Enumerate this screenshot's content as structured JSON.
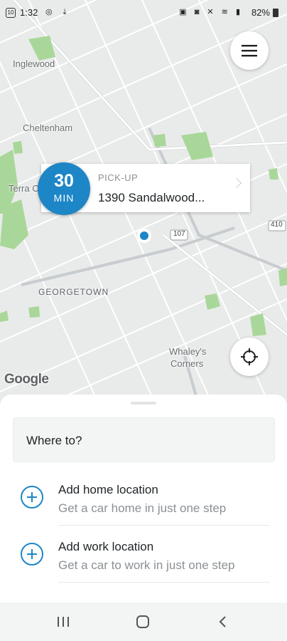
{
  "status_bar": {
    "time": "1:32",
    "notif_badge": "10",
    "battery": "82%"
  },
  "map": {
    "labels": {
      "inglewood": "Inglewood",
      "cheltenham": "Cheltenham",
      "terra_cotta": "Terra C",
      "georgetown": "GEORGETOWN",
      "whaleys_line1": "Whaley's",
      "whaleys_line2": "Corners",
      "route_107": "107",
      "route_410": "410"
    },
    "attribution": "Google",
    "colors": {
      "park": "#a9d79a",
      "road": "#ffffff",
      "highway": "#c7ccd0",
      "pin": "#1d86c6"
    }
  },
  "pickup": {
    "eta_number": "30",
    "eta_unit": "MIN",
    "kicker": "PICK-UP",
    "address": "1390 Sandalwood..."
  },
  "sheet": {
    "search_placeholder": "Where to?",
    "items": [
      {
        "title": "Add home location",
        "subtitle": "Get a car home in just one step"
      },
      {
        "title": "Add work location",
        "subtitle": "Get a car to work in just one step"
      }
    ]
  },
  "accent_color": "#1d86c6",
  "icons": [
    "menu-icon",
    "crosshair-icon",
    "plus-circle-icon",
    "nav-recents-icon",
    "nav-home-icon",
    "nav-back-icon"
  ]
}
